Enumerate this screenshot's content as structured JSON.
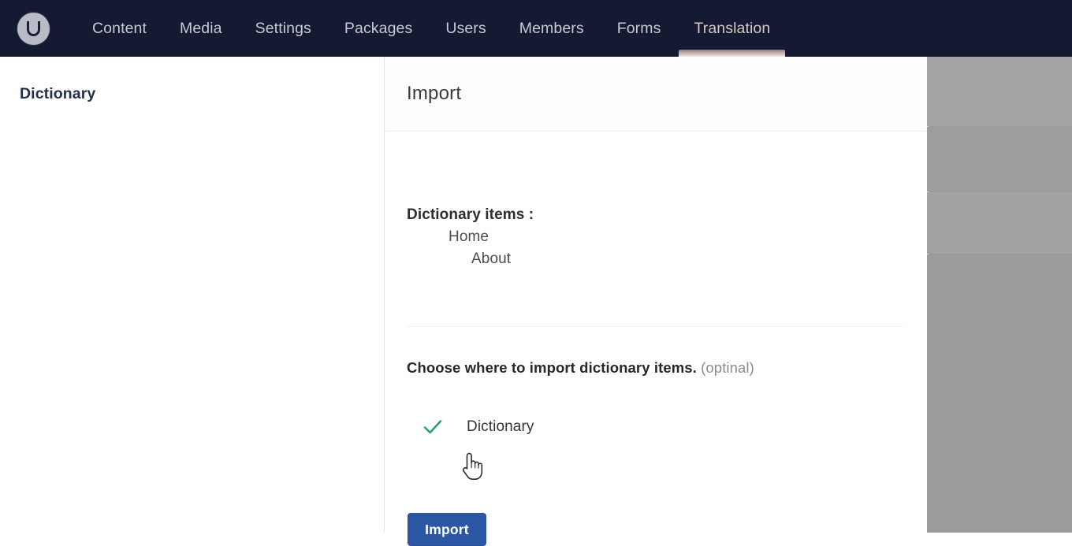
{
  "topnav": {
    "logo_icon": "umbraco-logo-icon",
    "items": [
      {
        "label": "Content",
        "active": false
      },
      {
        "label": "Media",
        "active": false
      },
      {
        "label": "Settings",
        "active": false
      },
      {
        "label": "Packages",
        "active": false
      },
      {
        "label": "Users",
        "active": false
      },
      {
        "label": "Members",
        "active": false
      },
      {
        "label": "Forms",
        "active": false
      },
      {
        "label": "Translation",
        "active": true
      }
    ],
    "background_color": "#131a31",
    "active_indicator_color": "#cbb9b6"
  },
  "sidebar": {
    "heading": "Dictionary"
  },
  "panel": {
    "title": "Import",
    "items_label": "Dictionary items :",
    "items": [
      {
        "label": "Home",
        "level": 1
      },
      {
        "label": "About",
        "level": 2
      }
    ],
    "choose_text": "Choose where to import dictionary items.",
    "choose_optional": "(optinal)",
    "target": {
      "check_icon": "green-check-icon",
      "check_color": "#2ba36a",
      "label": "Dictionary",
      "selected": true
    },
    "import_button_label": "Import",
    "import_button_color": "#2b57a5"
  },
  "cursor": {
    "icon": "pointing-hand-cursor"
  }
}
